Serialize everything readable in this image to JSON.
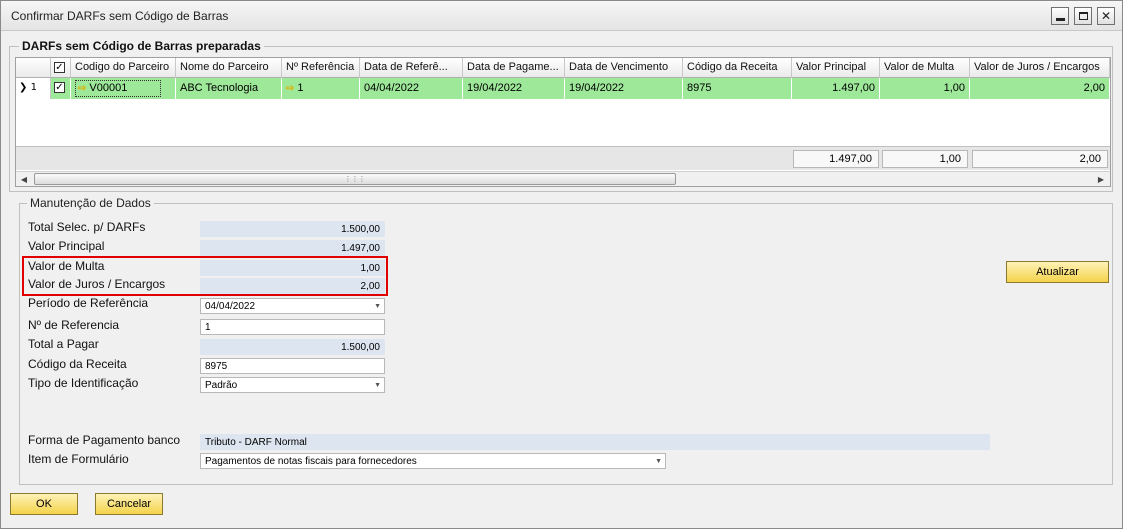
{
  "window": {
    "title": "Confirmar DARFs sem Código de Barras"
  },
  "section1": {
    "title": "DARFs sem Código de Barras preparadas"
  },
  "grid": {
    "headers": [
      "",
      "Codigo do Parceiro",
      "Nome do Parceiro",
      "Nº Referência",
      "Data de Referê...",
      "Data de Pagame...",
      "Data de Vencimento",
      "Código da Receita",
      "Valor Principal",
      "Valor de Multa",
      "Valor de Juros / Encargos"
    ],
    "row": {
      "index": "1",
      "partner_code": "V00001",
      "partner_name": "ABC Tecnologia",
      "ref_number": "1",
      "ref_date": "04/04/2022",
      "pay_date": "19/04/2022",
      "due_date": "19/04/2022",
      "revenue_code": "8975",
      "principal": "1.497,00",
      "fine": "1,00",
      "interest": "2,00"
    },
    "totals": {
      "principal": "1.497,00",
      "fine": "1,00",
      "interest": "2,00"
    }
  },
  "section2": {
    "title": "Manutenção de Dados",
    "fields": {
      "total_selected_label": "Total Selec. p/ DARFs",
      "total_selected_value": "1.500,00",
      "principal_label": "Valor Principal",
      "principal_value": "1.497,00",
      "fine_label": "Valor de Multa",
      "fine_value": "1,00",
      "interest_label": "Valor de Juros / Encargos",
      "interest_value": "2,00",
      "period_label": "Período de Referência",
      "period_value": "04/04/2022",
      "ref_label": "Nº de Referencia",
      "ref_value": "1",
      "total_pay_label": "Total a Pagar",
      "total_pay_value": "1.500,00",
      "revenue_label": "Código da Receita",
      "revenue_value": "8975",
      "id_type_label": "Tipo de Identificação",
      "id_type_value": "Padrão",
      "payment_form_label": "Forma de Pagamento banco",
      "payment_form_value": "Tributo - DARF Normal",
      "form_item_label": "Item de Formulário",
      "form_item_value": "Pagamentos de notas fiscais para fornecedores"
    },
    "update_button": "Atualizar"
  },
  "footer": {
    "ok_button": "OK",
    "cancel_button": "Cancelar"
  },
  "colors": {
    "selected_row": "#9ee89a",
    "highlight_border": "#e00000",
    "button_fill": "#f3d34a",
    "readonly_field": "#dde6f0"
  }
}
